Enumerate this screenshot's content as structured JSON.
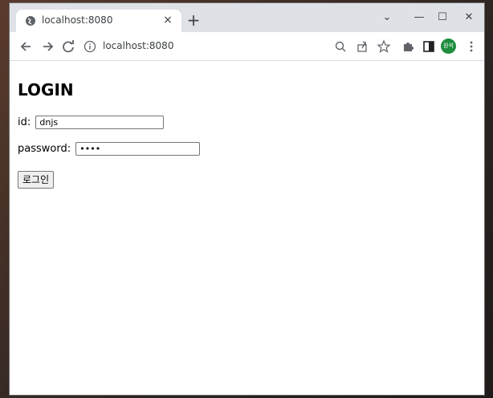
{
  "browser": {
    "tab": {
      "title": "localhost:8080",
      "close_label": "×"
    },
    "new_tab_label": "+",
    "window_controls": {
      "dropdown": "⌄",
      "minimize": "—",
      "maximize": "☐",
      "close": "✕"
    },
    "address": "localhost:8080",
    "profile_initials": "원석"
  },
  "page": {
    "heading": "LOGIN",
    "id_label": "id:",
    "id_value": "dnjs",
    "password_label": "password:",
    "password_value": "••••",
    "login_button": "로그인"
  }
}
